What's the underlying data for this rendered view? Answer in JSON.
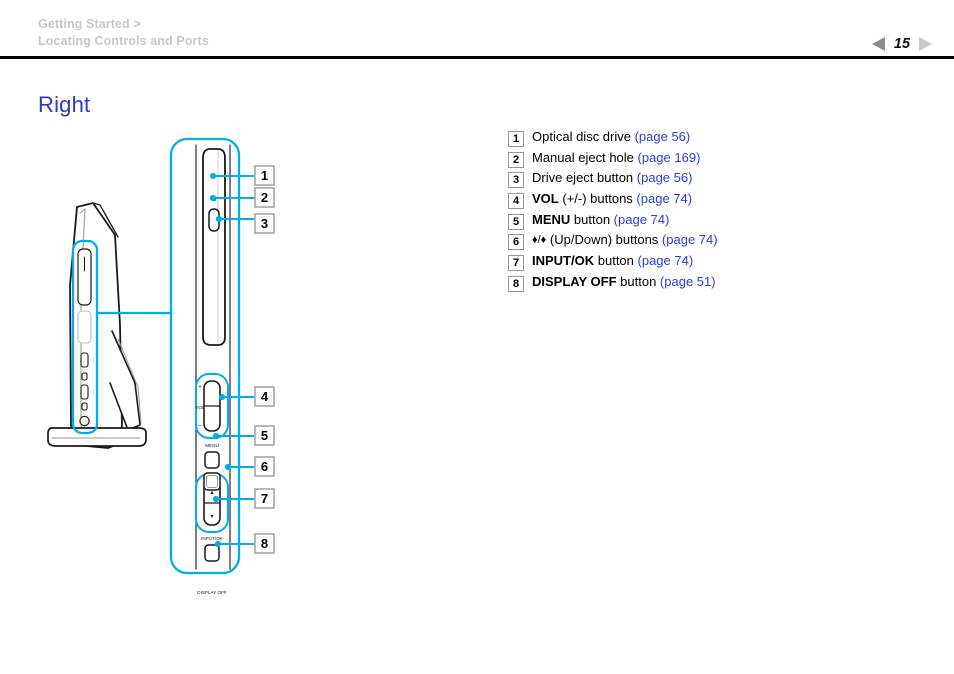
{
  "header": {
    "breadcrumb_line1": "Getting Started >",
    "breadcrumb_line2": "Locating Controls and Ports",
    "page_number": "15",
    "prev_icon": "triangle-left-icon",
    "next_icon": "triangle-right-icon"
  },
  "section": {
    "title": "Right",
    "title_color": "#2b3bc4"
  },
  "colors": {
    "accent_blue": "#00aeef",
    "link_blue": "#2a3ee0",
    "heading_blue": "#2b3bc4",
    "breadcrumb_gray": "#c8c8c8",
    "rule_black": "#000000",
    "callout_border": "#9a9a9a"
  },
  "legend": {
    "items": [
      {
        "num": "1",
        "label": "Optical disc drive",
        "page_ref": "(page 56)",
        "bold_prefix": ""
      },
      {
        "num": "2",
        "label": "Manual eject hole",
        "page_ref": "(page 169)",
        "bold_prefix": ""
      },
      {
        "num": "3",
        "label": "Drive eject button",
        "page_ref": "(page 56)",
        "bold_prefix": ""
      },
      {
        "num": "4",
        "label": "(+/-) buttons",
        "page_ref": "(page 74)",
        "bold_prefix": "VOL"
      },
      {
        "num": "5",
        "label": "button",
        "page_ref": "(page 74)",
        "bold_prefix": "MENU"
      },
      {
        "num": "6",
        "label": "(Up/Down) buttons",
        "page_ref": "(page 74)",
        "bold_prefix": "",
        "glyph": "♦/♦"
      },
      {
        "num": "7",
        "label": "button",
        "page_ref": "(page 74)",
        "bold_prefix": "INPUT/OK"
      },
      {
        "num": "8",
        "label": "button",
        "page_ref": "(page 51)",
        "bold_prefix": "DISPLAY OFF"
      }
    ]
  },
  "figure": {
    "description": "Right side view of all-in-one computer with detail panel of side edge controls",
    "device_side_view_label": "computer-side-view",
    "detail_panel_label": "right-edge-detail-panel",
    "control_labels": {
      "vol_plus": "+",
      "vol_name": "VOL",
      "vol_minus": "–",
      "menu": "MENU",
      "up": "▲",
      "down": "▼",
      "input_ok": "INPUT/OK",
      "display_off": "DISPLAY OFF"
    },
    "callouts": [
      "1",
      "2",
      "3",
      "4",
      "5",
      "6",
      "7",
      "8"
    ]
  }
}
